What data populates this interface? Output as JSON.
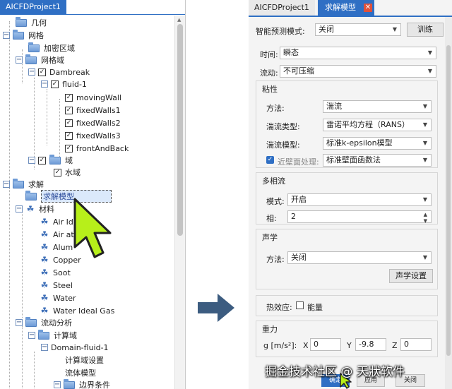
{
  "left_panel": {
    "tab_title": "AICFDProject1",
    "tree": {
      "geometry": "几何",
      "mesh": "网格",
      "refine_region": "加密区域",
      "mesh_domain": "网格域",
      "dambreak": "Dambreak",
      "fluid1": "fluid-1",
      "moving_wall": "movingWall",
      "fixed_walls1": "fixedWalls1",
      "fixed_walls2": "fixedWalls2",
      "fixed_walls3": "fixedWalls3",
      "front_and_back": "frontAndBack",
      "domain": "域",
      "water_domain": "水域",
      "solve": "求解",
      "solver_model": "求解模型",
      "materials": "材料",
      "mat_air_ideal": "Air Ide",
      "mat_air_at": "Air at",
      "mat_aluminum": "Alum",
      "mat_copper": "Copper",
      "mat_soot": "Soot",
      "mat_steel": "Steel",
      "mat_water": "Water",
      "mat_water_ideal_gas": "Water Ideal Gas",
      "flow_analysis": "流动分析",
      "compute_domain": "计算域",
      "domain_fluid1": "Domain-fluid-1",
      "compute_domain_settings": "计算域设置",
      "fluid_model": "流体模型",
      "boundary_conditions": "边界条件"
    }
  },
  "right_panel": {
    "tabs": {
      "project": "AICFDProject1",
      "solver": "求解模型",
      "close": "✕"
    },
    "smart_predict": {
      "label": "智能预测模式:",
      "value": "关闭",
      "train_button": "训练"
    },
    "time": {
      "label": "时间:",
      "value": "瞬态"
    },
    "flow": {
      "label": "流动:",
      "value": "不可压缩"
    },
    "viscous": {
      "title": "粘性",
      "method_label": "方法:",
      "method_value": "湍流",
      "turb_type_label": "湍流类型:",
      "turb_type_value": "雷诺平均方程（RANS）",
      "turb_model_label": "湍流模型:",
      "turb_model_value": "标准k-epsilon模型",
      "near_wall_label": "近壁面处理:",
      "near_wall_value": "标准壁面函数法",
      "near_wall_checked": true
    },
    "multiphase": {
      "title": "多相流",
      "mode_label": "模式:",
      "mode_value": "开启",
      "phase_label": "相:",
      "phase_value": "2"
    },
    "acoustics": {
      "title": "声学",
      "method_label": "方法:",
      "method_value": "关闭",
      "settings_button": "声学设置"
    },
    "thermal": {
      "label": "热效应:",
      "energy_label": "能量",
      "energy_checked": false
    },
    "gravity": {
      "title": "重力",
      "label": "g [m/s²]:",
      "x_label": "X",
      "x_value": "0",
      "y_label": "Y",
      "y_value": "-9.8",
      "z_label": "Z",
      "z_value": "0"
    },
    "footer": {
      "ok": "确定",
      "apply": "应用",
      "close": "关闭"
    }
  },
  "watermark": "掘金技术社区 @ 天狀软件",
  "colors": {
    "accent": "#2f6fc4",
    "cursor": "#b7ef1a",
    "arrow": "#3c5c80"
  }
}
